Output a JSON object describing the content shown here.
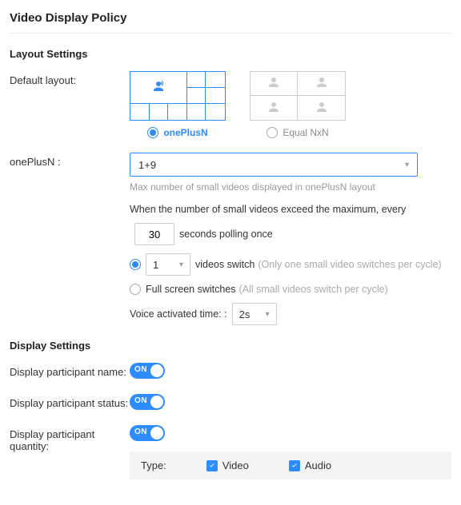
{
  "page_title": "Video Display Policy",
  "layout_settings": {
    "title": "Layout Settings",
    "default_layout_label": "Default layout:",
    "options": {
      "onePlusN": "onePlusN",
      "equalNxN": "Equal NxN"
    },
    "selected": "onePlusN"
  },
  "onePlusN": {
    "label": "onePlusN :",
    "select_value": "1+9",
    "hint": "Max number of small videos displayed in onePlusN layout",
    "exceed_text_a": "When the number of small videos exceed the maximum, every",
    "polling_seconds": "30",
    "exceed_text_b": "seconds polling once",
    "switch_mode": "videos",
    "videos_switch_count": "1",
    "videos_switch_label": "videos switch",
    "videos_switch_hint": "(Only one small video switches per cycle)",
    "full_switch_label": "Full screen switches",
    "full_switch_hint": "(All small videos switch per cycle)",
    "voice_label": "Voice activated time:   :",
    "voice_value": "2s"
  },
  "display_settings": {
    "title": "Display Settings",
    "name_label": "Display participant name:",
    "name_on": "ON",
    "status_label": "Display participant status:",
    "status_on": "ON",
    "quantity_label": "Display participant quantity:",
    "quantity_on": "ON",
    "type_label": "Type:",
    "video_label": "Video",
    "audio_label": "Audio"
  }
}
